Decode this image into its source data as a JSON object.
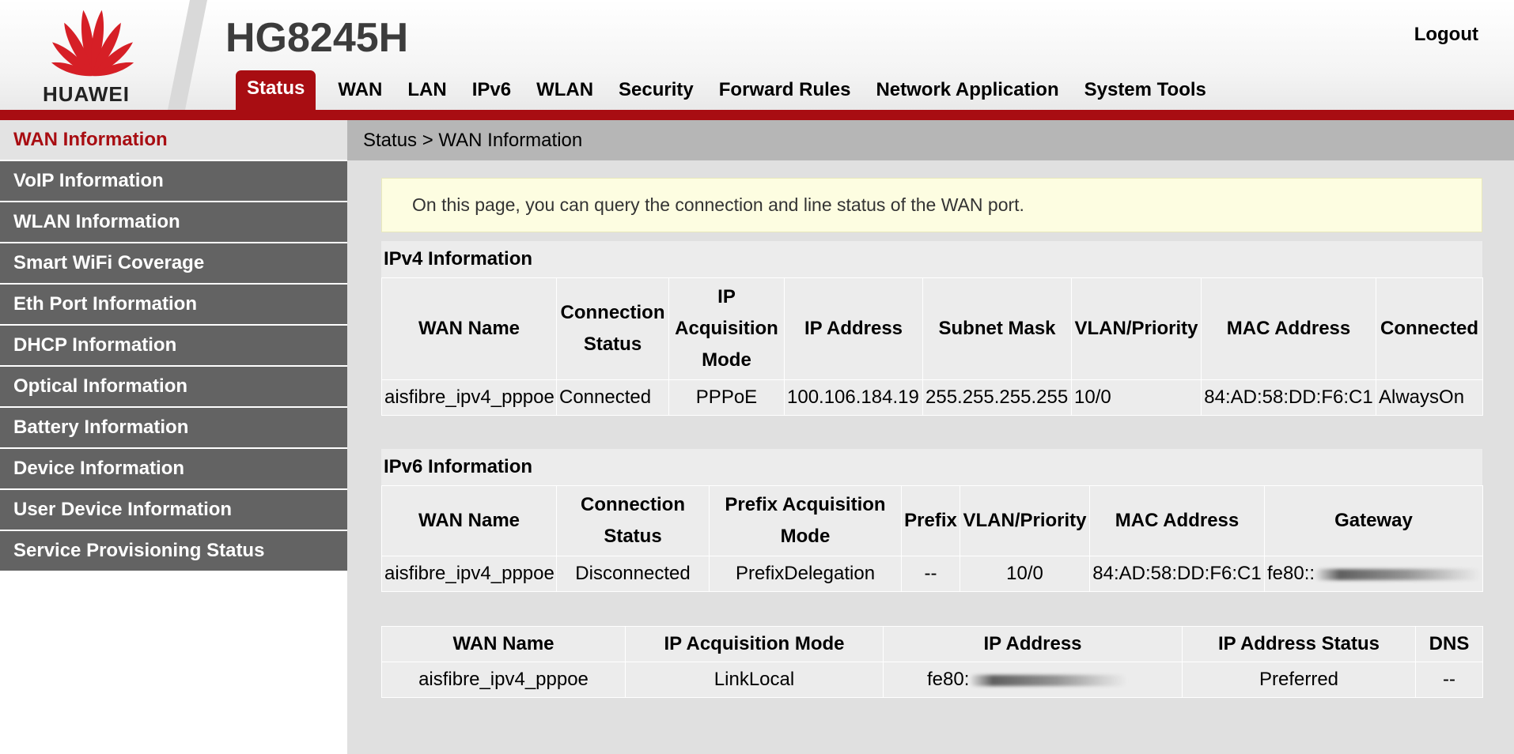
{
  "brand": {
    "logo_text": "HUAWEI",
    "model": "HG8245H",
    "accent_color": "#a80d12"
  },
  "header": {
    "logout_label": "Logout"
  },
  "nav": {
    "tabs": [
      {
        "label": "Status",
        "active": true
      },
      {
        "label": "WAN"
      },
      {
        "label": "LAN"
      },
      {
        "label": "IPv6"
      },
      {
        "label": "WLAN"
      },
      {
        "label": "Security"
      },
      {
        "label": "Forward Rules"
      },
      {
        "label": "Network Application"
      },
      {
        "label": "System Tools"
      }
    ]
  },
  "sidebar": {
    "items": [
      {
        "label": "WAN Information",
        "active": true
      },
      {
        "label": "VoIP Information"
      },
      {
        "label": "WLAN Information"
      },
      {
        "label": "Smart WiFi Coverage"
      },
      {
        "label": "Eth Port Information"
      },
      {
        "label": "DHCP Information"
      },
      {
        "label": "Optical Information"
      },
      {
        "label": "Battery Information"
      },
      {
        "label": "Device Information"
      },
      {
        "label": "User Device Information"
      },
      {
        "label": "Service Provisioning Status"
      }
    ]
  },
  "breadcrumb": "Status > WAN Information",
  "notice": "On this page, you can query the connection and line status of the WAN port.",
  "ipv4": {
    "title": "IPv4 Information",
    "headers": [
      "WAN Name",
      "Connection Status",
      "IP Acquisition Mode",
      "IP Address",
      "Subnet Mask",
      "VLAN/Priority",
      "MAC Address",
      "Connected"
    ],
    "row": [
      "aisfibre_ipv4_pppoe",
      "Connected",
      "PPPoE",
      "100.106.184.19",
      "255.255.255.255",
      "10/0",
      "84:AD:58:DD:F6:C1",
      "AlwaysOn"
    ]
  },
  "ipv6": {
    "title": "IPv6 Information",
    "headers": [
      "WAN Name",
      "Connection Status",
      "Prefix Acquisition Mode",
      "Prefix",
      "VLAN/Priority",
      "MAC Address",
      "Gateway"
    ],
    "row": [
      "aisfibre_ipv4_pppoe",
      "Disconnected",
      "PrefixDelegation",
      "--",
      "10/0",
      "84:AD:58:DD:F6:C1",
      "fe80::"
    ]
  },
  "ipv6_address": {
    "headers": [
      "WAN Name",
      "IP Acquisition Mode",
      "IP Address",
      "IP Address Status",
      "DNS"
    ],
    "row": [
      "aisfibre_ipv4_pppoe",
      "LinkLocal",
      "fe80:",
      "Preferred",
      "--"
    ]
  }
}
